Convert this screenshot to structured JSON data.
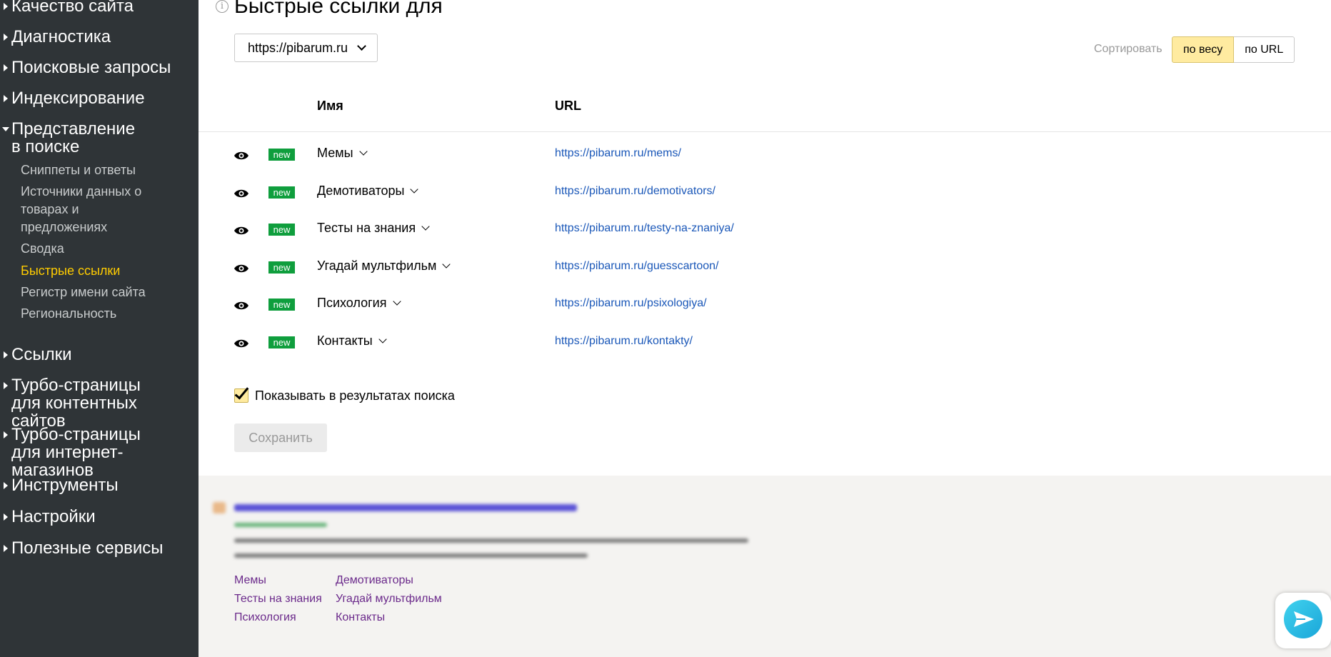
{
  "sidebar": {
    "top_items": [
      "Качество сайта",
      "Диагностика",
      "Поисковые запросы",
      "Индексирование",
      "Представление в поиске",
      "Ссылки",
      "Турбо-страницы для контентных сайтов",
      "Турбо-страницы для интернет-магазинов",
      "Инструменты",
      "Настройки",
      "Полезные сервисы"
    ],
    "expanded_item": "Представление в поиске",
    "sub_items": [
      "Сниппеты и ответы",
      "Источники данных о товарах и предложениях",
      "Сводка",
      "Быстрые ссылки",
      "Регистр имени сайта",
      "Региональность"
    ],
    "active_sub_item": "Быстрые ссылки",
    "active_color": "#ffcc00"
  },
  "main": {
    "title": "Быстрые ссылки для",
    "domain": "https://pibarum.ru",
    "sort_label": "Сортировать",
    "sort_options": [
      "по весу",
      "по URL"
    ],
    "sort_selected": "по весу",
    "columns": {
      "name": "Имя",
      "url": "URL"
    },
    "links": [
      {
        "badge": "new",
        "name": "Мемы",
        "url": "https://pibarum.ru/mems/"
      },
      {
        "badge": "new",
        "name": "Демотиваторы",
        "url": "https://pibarum.ru/demotivators/"
      },
      {
        "badge": "new",
        "name": "Тесты на знания",
        "url": "https://pibarum.ru/testy-na-znaniya/"
      },
      {
        "badge": "new",
        "name": "Угадай мультфильм",
        "url": "https://pibarum.ru/guesscartoon/"
      },
      {
        "badge": "new",
        "name": "Психология",
        "url": "https://pibarum.ru/psixologiya/"
      },
      {
        "badge": "new",
        "name": "Контакты",
        "url": "https://pibarum.ru/kontakty/"
      }
    ],
    "show_in_results_label": "Показывать в результатах поиска",
    "show_in_results_checked": true,
    "save_label": "Сохранить"
  },
  "preview": {
    "quick_links": [
      "Мемы",
      "Демотиваторы",
      "Тесты на знания",
      "Угадай мультфильм",
      "Психология",
      "Контакты"
    ]
  },
  "colors": {
    "sidebar_bg": "#2f3437",
    "link_url": "#1a57b8",
    "badge_new": "#0f9e3d",
    "sort_active_bg": "#ffeba0",
    "preview_link": "#6b2a8b"
  }
}
